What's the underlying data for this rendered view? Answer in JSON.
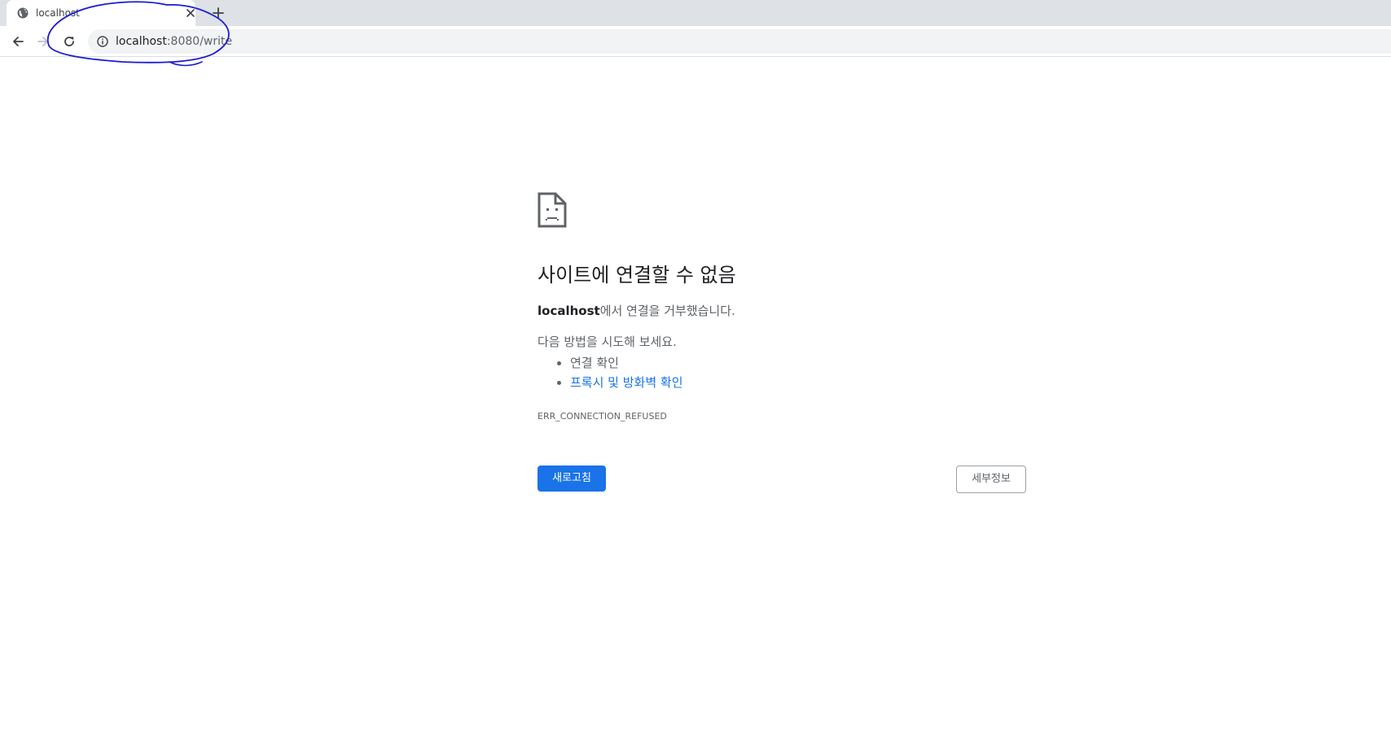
{
  "browser": {
    "tab": {
      "title": "localhost",
      "favicon": "globe-icon"
    },
    "toolbar": {
      "url_host": "localhost",
      "url_rest": ":8080/write"
    },
    "annotation_color": "#1a1ad8"
  },
  "error_page": {
    "heading": "사이트에 연결할 수 없음",
    "message_host": "localhost",
    "message_rest": "에서 연결을 거부했습니다.",
    "suggest_intro": "다음 방법을 시도해 보세요.",
    "suggestions": [
      "연결 확인",
      "프록시 및 방화벽 확인"
    ],
    "error_code": "ERR_CONNECTION_REFUSED",
    "reload_label": "새로고침",
    "details_label": "세부정보",
    "accent_color": "#1a73e8"
  }
}
